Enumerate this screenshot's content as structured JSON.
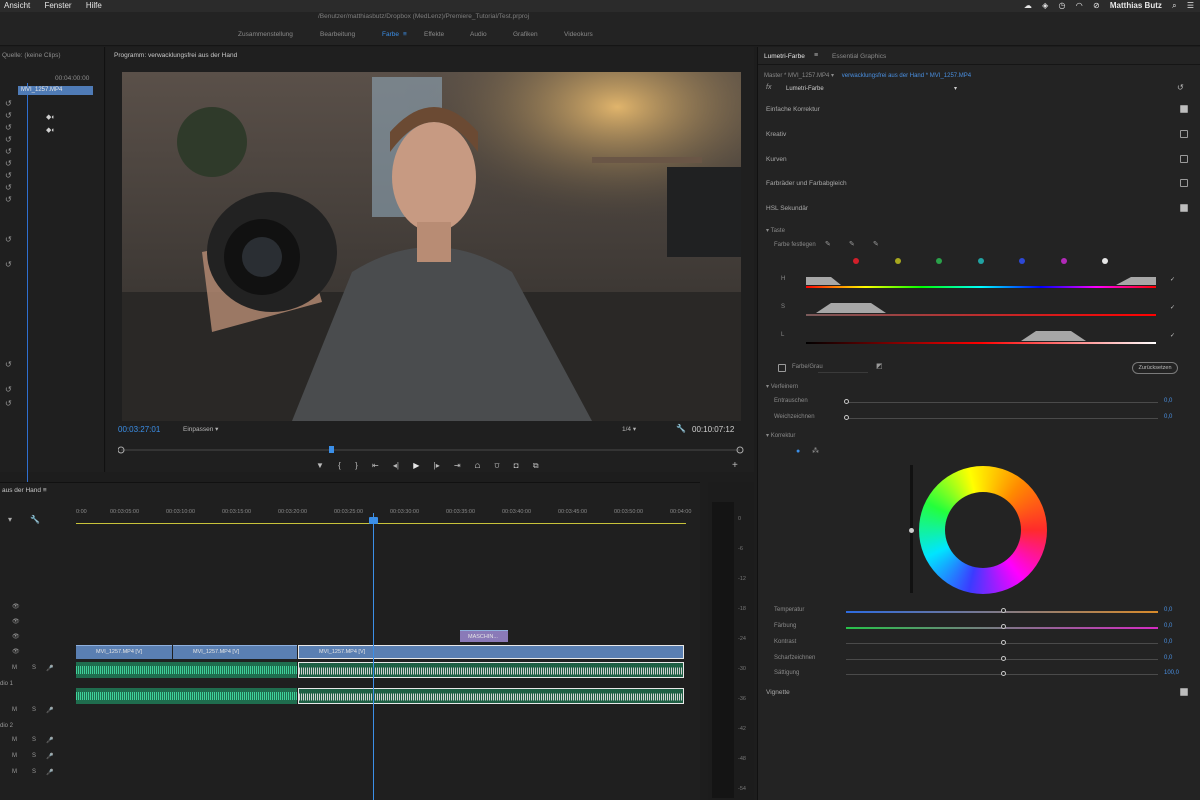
{
  "menubar": {
    "items": [
      "Ansicht",
      "Fenster",
      "Hilfe"
    ],
    "user": "Matthias Butz"
  },
  "titlebar": {
    "path": "/Benutzer/matthiasbutz/Dropbox (MedLenz)/Premiere_Tutorial/Test.prproj"
  },
  "workspace_tabs": [
    {
      "label": "Zusammenstellung",
      "active": false
    },
    {
      "label": "Bearbeitung",
      "active": false
    },
    {
      "label": "Farbe",
      "active": true
    },
    {
      "label": "Effekte",
      "active": false
    },
    {
      "label": "Audio",
      "active": false
    },
    {
      "label": "Grafiken",
      "active": false
    },
    {
      "label": "Videokurs",
      "active": false
    }
  ],
  "source": {
    "header": "Quelle: (keine Clips)",
    "timecode": "00:04:00:00",
    "clip": "MVI_1257.MP4"
  },
  "program": {
    "header": "Programm: verwacklungsfrei aus der Hand",
    "timecode_current": "00:03:27:01",
    "fit": "Einpassen",
    "quality": "1/4",
    "timecode_duration": "00:10:07:12",
    "playhead_fraction": 0.34
  },
  "timeline": {
    "header": "aus der Hand",
    "ruler": [
      "0:00",
      "00:03:05:00",
      "00:03:10:00",
      "00:03:15:00",
      "00:03:20:00",
      "00:03:25:00",
      "00:03:30:00",
      "00:03:35:00",
      "00:03:40:00",
      "00:03:45:00",
      "00:03:50:00",
      "00:04:00"
    ],
    "clips_v1": [
      "MVI_1257.MP4 [V]",
      "MVI_1257.MP4 [V]",
      "MVI_1257.MP4 [V]"
    ],
    "nested_clip": "MASCHIN...",
    "track_labels": [
      "dio 1",
      "dio 2"
    ],
    "meter_labels": [
      "0",
      "-6",
      "-12",
      "-18",
      "-24",
      "-30",
      "-36",
      "-42",
      "-48",
      "-54"
    ]
  },
  "lumetri": {
    "tab_active": "Lumetri-Farbe",
    "tab_other": "Essential Graphics",
    "clip_master": "Master * MVI_1257.MP4",
    "clip_seq": "verwacklungsfrei aus der Hand * MVI_1257.MP4",
    "fx_symbol": "fx",
    "fx_name": "Lumetri-Farbe",
    "sections": [
      {
        "label": "Einfache Korrektur",
        "checked": true
      },
      {
        "label": "Kreativ",
        "checked": false
      },
      {
        "label": "Kurven",
        "checked": false
      },
      {
        "label": "Farbräder und Farbabgleich",
        "checked": false
      },
      {
        "label": "HSL Sekundär",
        "checked": true
      }
    ],
    "key": {
      "title": "Taste",
      "set_color": "Farbe festlegen",
      "swatches": [
        "#d21f2a",
        "#a8a81e",
        "#2aa14a",
        "#21a3a3",
        "#2d48d6",
        "#b129b8",
        "#e6e6e6"
      ],
      "channels": [
        "H",
        "S",
        "L"
      ]
    },
    "mask": {
      "label": "Farbe/Grau",
      "reset": "Zurücksetzen"
    },
    "refine": {
      "title": "Verfeinern",
      "items": [
        {
          "label": "Entrauschen",
          "value": "0,0"
        },
        {
          "label": "Weichzeichnen",
          "value": "0,0"
        }
      ]
    },
    "correction": {
      "title": "Korrektur",
      "sliders": [
        {
          "label": "Temperatur",
          "value": "0,0"
        },
        {
          "label": "Färbung",
          "value": "0,0"
        },
        {
          "label": "Kontrast",
          "value": "0,0"
        },
        {
          "label": "Scharfzeichnen",
          "value": "0,0"
        },
        {
          "label": "Sättigung",
          "value": "100,0"
        }
      ]
    },
    "vignette": {
      "label": "Vignette",
      "checked": true
    }
  }
}
